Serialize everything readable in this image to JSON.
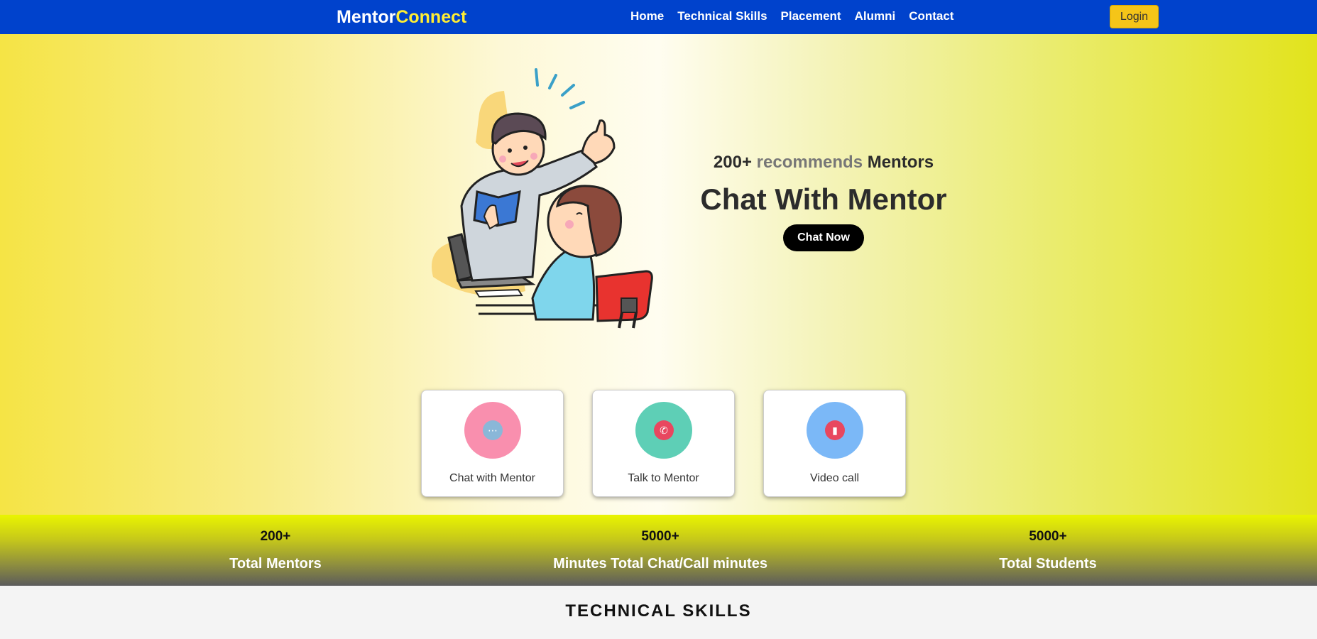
{
  "nav": {
    "brand_part1": "Mentor",
    "brand_part2": "Connect",
    "links": [
      "Home",
      "Technical Skills",
      "Placement",
      "Alumni",
      "Contact"
    ],
    "login_label": "Login"
  },
  "hero": {
    "subtitle_count": "200+",
    "subtitle_word": "recommends",
    "subtitle_end": "Mentors",
    "title": "Chat With Mentor",
    "cta_label": "Chat Now"
  },
  "services": [
    {
      "label": "Chat with Mentor",
      "icon": "chat-bubble-icon",
      "color": "#f98fae"
    },
    {
      "label": "Talk to Mentor",
      "icon": "phone-icon",
      "color": "#5ecfb6"
    },
    {
      "label": "Video call",
      "icon": "video-camera-icon",
      "color": "#7bb8f7"
    }
  ],
  "stats": [
    {
      "value": "200+",
      "label": "Total Mentors"
    },
    {
      "value": "5000+",
      "label": "Minutes Total Chat/Call minutes"
    },
    {
      "value": "5000+",
      "label": "Total Students"
    }
  ],
  "section_title": "TECHNICAL SKILLS",
  "colors": {
    "nav_bg": "#0042cc",
    "brand_accent": "#ffee33",
    "login_bg": "#f5c518"
  }
}
